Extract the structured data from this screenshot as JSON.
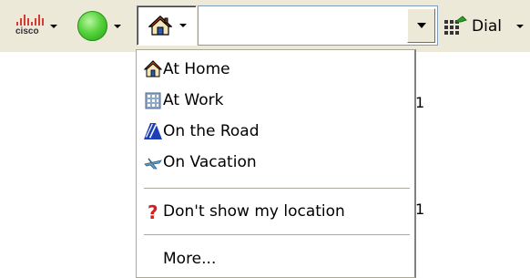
{
  "toolbar": {
    "logo_text": "cisco",
    "location_button_icon": "home-icon",
    "location_input_value": "",
    "dial_label": "Dial",
    "presence_color": "#55d23b"
  },
  "menu": {
    "items": [
      {
        "label": "At Home",
        "icon": "home-icon"
      },
      {
        "label": "At Work",
        "icon": "office-building-icon"
      },
      {
        "label": "On the Road",
        "icon": "road-icon"
      },
      {
        "label": "On Vacation",
        "icon": "airplane-icon"
      },
      {
        "label": "Don't show my location",
        "icon": "question-mark-icon"
      },
      {
        "label": "More...",
        "icon": ""
      }
    ]
  },
  "background": {
    "fragment_1": "1",
    "fragment_2": "1"
  }
}
